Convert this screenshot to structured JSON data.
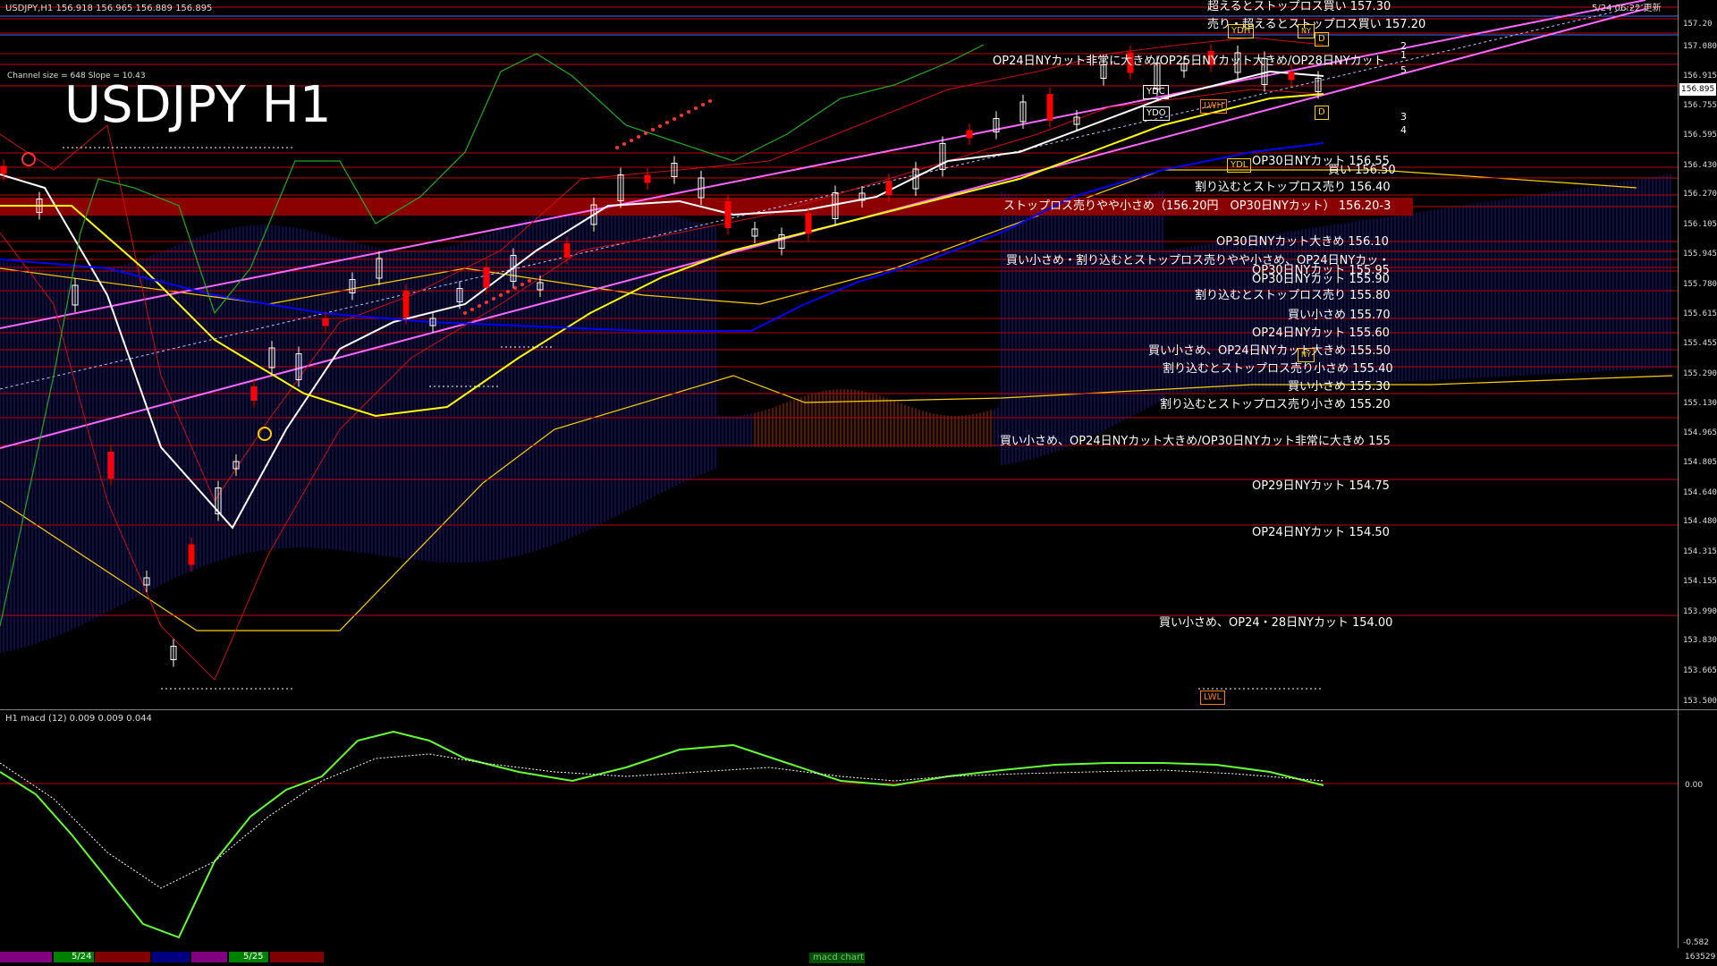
{
  "header": {
    "symbol_info": "USDJPY,H1  156.918 156.965 156.889 156.895",
    "channel_info": "Channel size = 648 Slope = 10.43",
    "big_title": "USDJPY H1",
    "server_time": "5/24 06:22 更新"
  },
  "subwindow": {
    "title": "H1  macd (12) 0.009 0.009 0.044",
    "ticks": [
      "0.00",
      "-0.582"
    ]
  },
  "bottom_bar": {
    "date1": "5/24",
    "date2": "5/25",
    "center_label": "macd chart",
    "right_value": "163529"
  },
  "price_axis": [
    "157.20",
    "157.080",
    "156.915",
    "156.755",
    "156.595",
    "156.430",
    "156.270",
    "156.105",
    "155.945",
    "155.780",
    "155.615",
    "155.455",
    "155.290",
    "155.130",
    "154.965",
    "154.805",
    "154.640",
    "154.480",
    "154.315",
    "154.155",
    "153.990",
    "153.830",
    "153.665",
    "153.500"
  ],
  "current_price": "156.895",
  "tags": {
    "ydh": "YDH",
    "ydc": "YDC",
    "ydo": "YDO",
    "ydl": "YDL",
    "lwh": "LWH",
    "lwl": "LWL",
    "d1": "D",
    "d2": "D",
    "nv1": "NY",
    "nv2": "NY"
  },
  "fib_numbers": [
    "2",
    "1",
    "5",
    "3",
    "4"
  ],
  "levels": [
    {
      "text": "超えるとストップロス買い 157.30"
    },
    {
      "text": "売り・超えるとストップロス買い 157.20"
    },
    {
      "text": "OP24日NYカット非常に大きめ/OP25日NYカット大きめ/OP28日NYカット"
    },
    {
      "text": "OP30日NYカット 156.55"
    },
    {
      "text": "買い 156.50"
    },
    {
      "text": "割り込むとストップロス売り 156.40"
    },
    {
      "text": "ストップロス売りやや小さめ（156.20円　OP30日NYカット） 156.20-3"
    },
    {
      "text": "OP30日NYカット大きめ 156.10"
    },
    {
      "text": "買い小さめ・割り込むとストップロス売りやや小さめ、OP24日NYカッ・"
    },
    {
      "text": "OP30日NYカット 155.95"
    },
    {
      "text": "OP30日NYカット 155.90"
    },
    {
      "text": "割り込むとストップロス売り 155.80"
    },
    {
      "text": "買い小さめ 155.70"
    },
    {
      "text": "OP24日NYカット 155.60"
    },
    {
      "text": "買い小さめ、OP24日NYカット大きめ 155.50"
    },
    {
      "text": "割り込むとストップロス売り小さめ 155.40"
    },
    {
      "text": "買い小さめ 155.30"
    },
    {
      "text": "割り込むとストップロス売り小さめ 155.20"
    },
    {
      "text": "買い小さめ、OP24日NYカット大きめ/OP30日NYカット非常に大きめ 155"
    },
    {
      "text": "OP29日NYカット 154.75"
    },
    {
      "text": "OP24日NYカット 154.50"
    },
    {
      "text": "買い小さめ、OP24・28日NYカット 154.00"
    }
  ],
  "colors": {
    "candle_up": "#ffffff",
    "candle_down": "#ff0000",
    "level_line": "#c00000",
    "cloud": "#1a1aa0",
    "channel": "#ff66ff",
    "sma_short": "#ffffff",
    "sma_mid": "#ffff00",
    "sma_long": "#0000ff",
    "macd": "#66ff33",
    "signal": "#ffffff"
  }
}
